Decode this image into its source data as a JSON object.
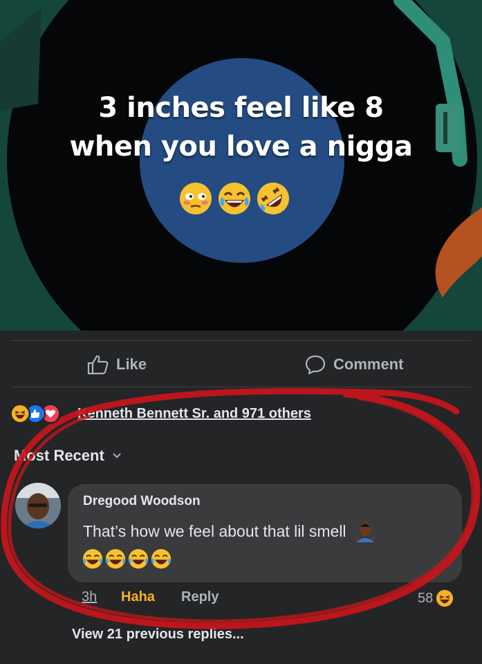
{
  "post": {
    "caption_line1": "3 inches feel like 8",
    "caption_line2": "when you love a nigga",
    "caption_emojis": [
      "flushed-face-emoji",
      "tears-of-joy-emoji",
      "rolling-laughing-emoji"
    ]
  },
  "actions": {
    "like_label": "Like",
    "like_icon": "thumbs-up-icon",
    "comment_label": "Comment",
    "comment_icon": "speech-bubble-icon"
  },
  "reactions": {
    "icons": [
      "haha-reaction-icon",
      "like-reaction-icon",
      "love-reaction-icon"
    ],
    "summary": "Kenneth Bennett Sr. and 971 others"
  },
  "sort": {
    "label": "Most Recent",
    "icon": "chevron-down-icon"
  },
  "comment": {
    "author": "Dregood Woodson",
    "text": "That’s how we feel about that lil smell",
    "text_emoji": "person-shrugging-emoji",
    "emojis": [
      "tears-of-joy-emoji",
      "tears-of-joy-emoji",
      "tears-of-joy-emoji",
      "tears-of-joy-emoji"
    ],
    "time": "3h",
    "reaction_label": "Haha",
    "reply_label": "Reply",
    "reaction_count": "58"
  },
  "view_replies": "View 21 previous replies...",
  "colors": {
    "background": "#242526",
    "bubble": "#3a3b3c",
    "haha": "#f7b125",
    "annotation_ring": "#c8151b"
  }
}
